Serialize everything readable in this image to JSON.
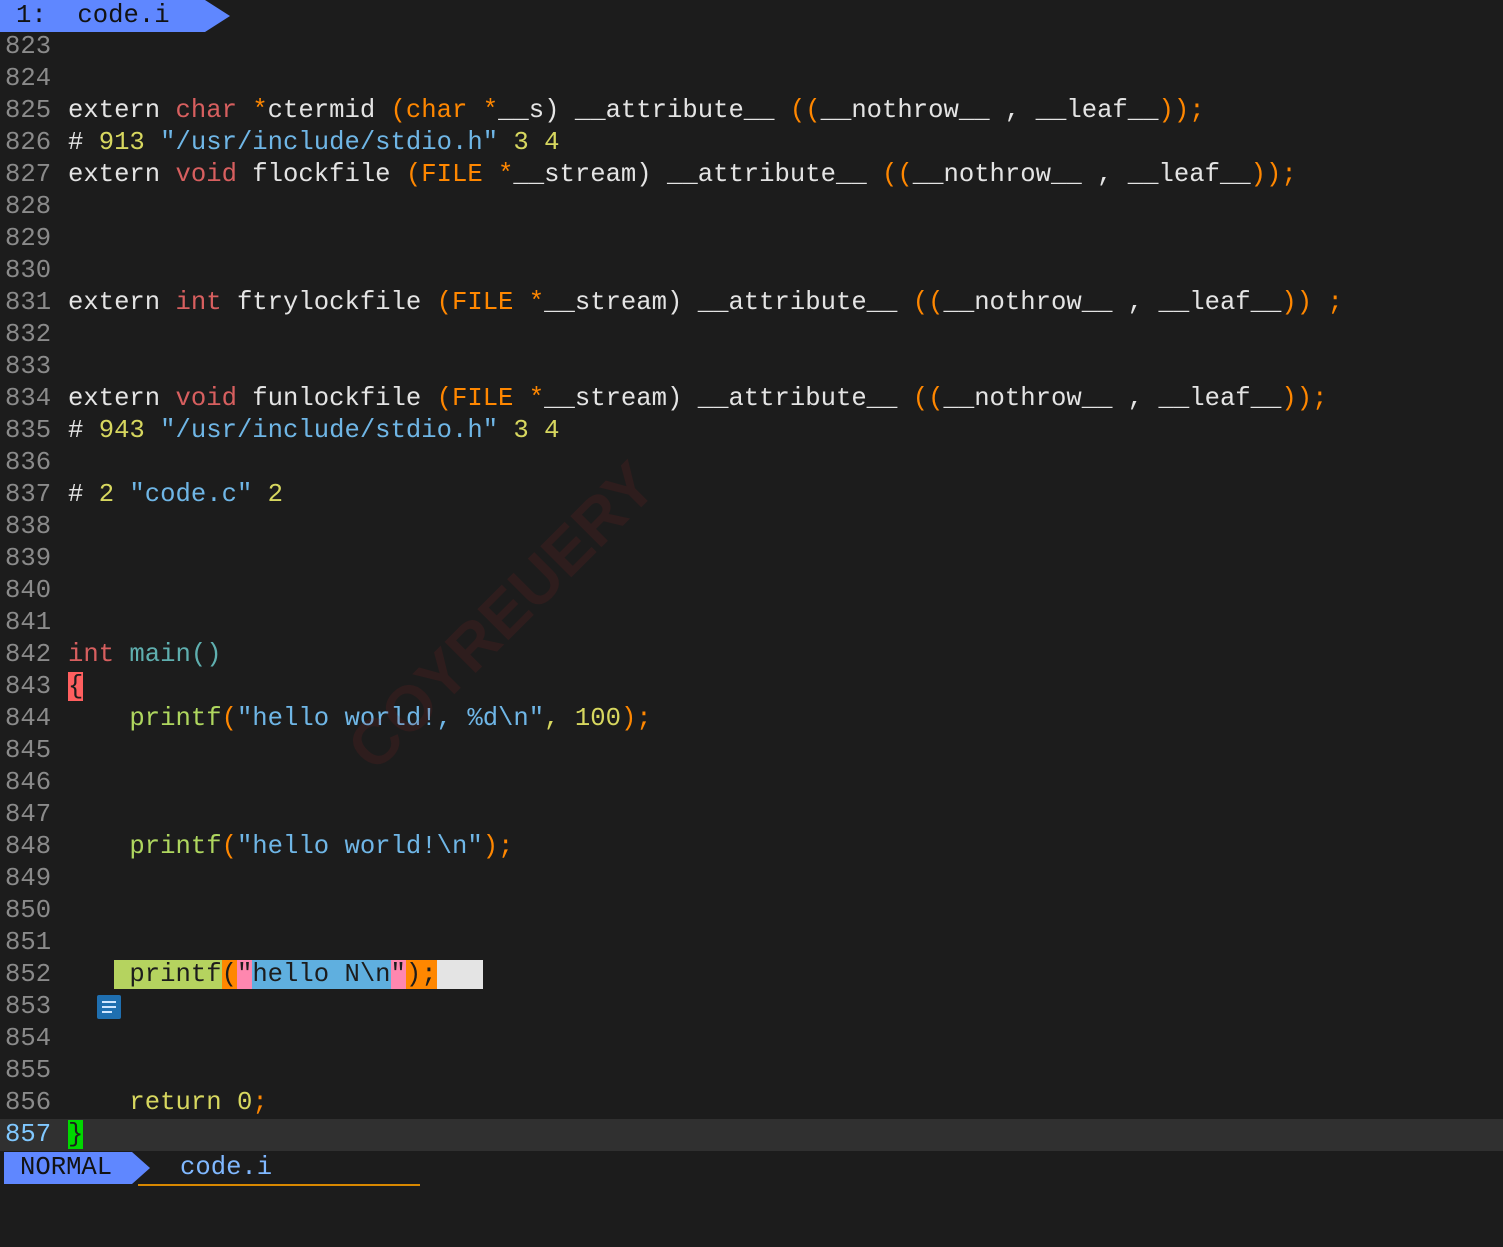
{
  "tabline": {
    "tab_label": "1:  code.i"
  },
  "lines": {
    "l823": "823",
    "l824": "824",
    "l825": "825",
    "l826": "826",
    "l827": "827",
    "l828": "828",
    "l829": "829",
    "l830": "830",
    "l831": "831",
    "l832": "832",
    "l833": "833",
    "l834": "834",
    "l835": "835",
    "l836": "836",
    "l837": "837",
    "l838": "838",
    "l839": "839",
    "l840": "840",
    "l841": "841",
    "l842": "842",
    "l843": "843",
    "l844": "844",
    "l845": "845",
    "l846": "846",
    "l847": "847",
    "l848": "848",
    "l849": "849",
    "l850": "850",
    "l851": "851",
    "l852": "852",
    "l853": "853",
    "l854": "854",
    "l855": "855",
    "l856": "856",
    "l857": "857"
  },
  "code": {
    "c825": {
      "a": "extern ",
      "b": "char",
      "c": " ",
      "d": "*",
      "e": "ctermid ",
      "f": "(char *",
      "g": "__s)",
      "h": " __attribute__ ",
      "i": "((",
      "j": "__nothrow__ , __leaf__",
      "k": "));"
    },
    "c826": {
      "a": "# ",
      "b": "913",
      "c": " \"/usr/include/stdio.h\"",
      "d": " 3 4"
    },
    "c827": {
      "a": "extern ",
      "b": "void",
      "c": " flockfile ",
      "d": "(FILE *",
      "e": "__stream)",
      "f": " __attribute__ ",
      "g": "((",
      "h": "__nothrow__ , __leaf__",
      "i": "));"
    },
    "c831": {
      "a": "extern ",
      "b": "int",
      "c": " ftrylockfile ",
      "d": "(FILE *",
      "e": "__stream)",
      "f": " __attribute__ ",
      "g": "((",
      "h": "__nothrow__ , __leaf__",
      "i": "))",
      "j": " ;"
    },
    "c834": {
      "a": "extern ",
      "b": "void",
      "c": " funlockfile ",
      "d": "(FILE *",
      "e": "__stream)",
      "f": " __attribute__ ",
      "g": "((",
      "h": "__nothrow__ , __leaf__",
      "i": "));"
    },
    "c835": {
      "a": "# ",
      "b": "943",
      "c": " \"/usr/include/stdio.h\"",
      "d": " 3 4"
    },
    "c837": {
      "a": "# ",
      "b": "2",
      "c": " \"code.c\"",
      "d": " 2"
    },
    "c842": {
      "a": "int",
      "b": " main",
      "c": "()"
    },
    "c843": {
      "a": "{"
    },
    "c844": {
      "a": "    printf",
      "b": "(",
      "c": "\"hello world!, %d\\n\"",
      "d": ", 100",
      "e": ");"
    },
    "c848": {
      "a": "    printf",
      "b": "(",
      "c": "\"hello world!\\n\"",
      "d": ");"
    },
    "c852": {
      "pre": "   ",
      "a": " printf",
      "b": "(",
      "c": "\"",
      "d": "hello N\\n",
      "e": "\"",
      "f": ")",
      "g": ";",
      "h": "   "
    },
    "c856": {
      "a": "    return ",
      "b": "0",
      "c": ";"
    },
    "c857": {
      "a": "}"
    }
  },
  "status": {
    "mode": "NORMAL",
    "filename": "code.i"
  },
  "watermark": {
    "text": "COYREUERY"
  },
  "icons": {
    "line853": "note-icon"
  },
  "colors": {
    "background": "#1c1c1c",
    "mode_accent": "#5f87ff",
    "keyword": "#d75f5f",
    "punctuation": "#ff8700",
    "string": "#6fb6e6",
    "number": "#d7d75f",
    "function": "#afd75f"
  }
}
